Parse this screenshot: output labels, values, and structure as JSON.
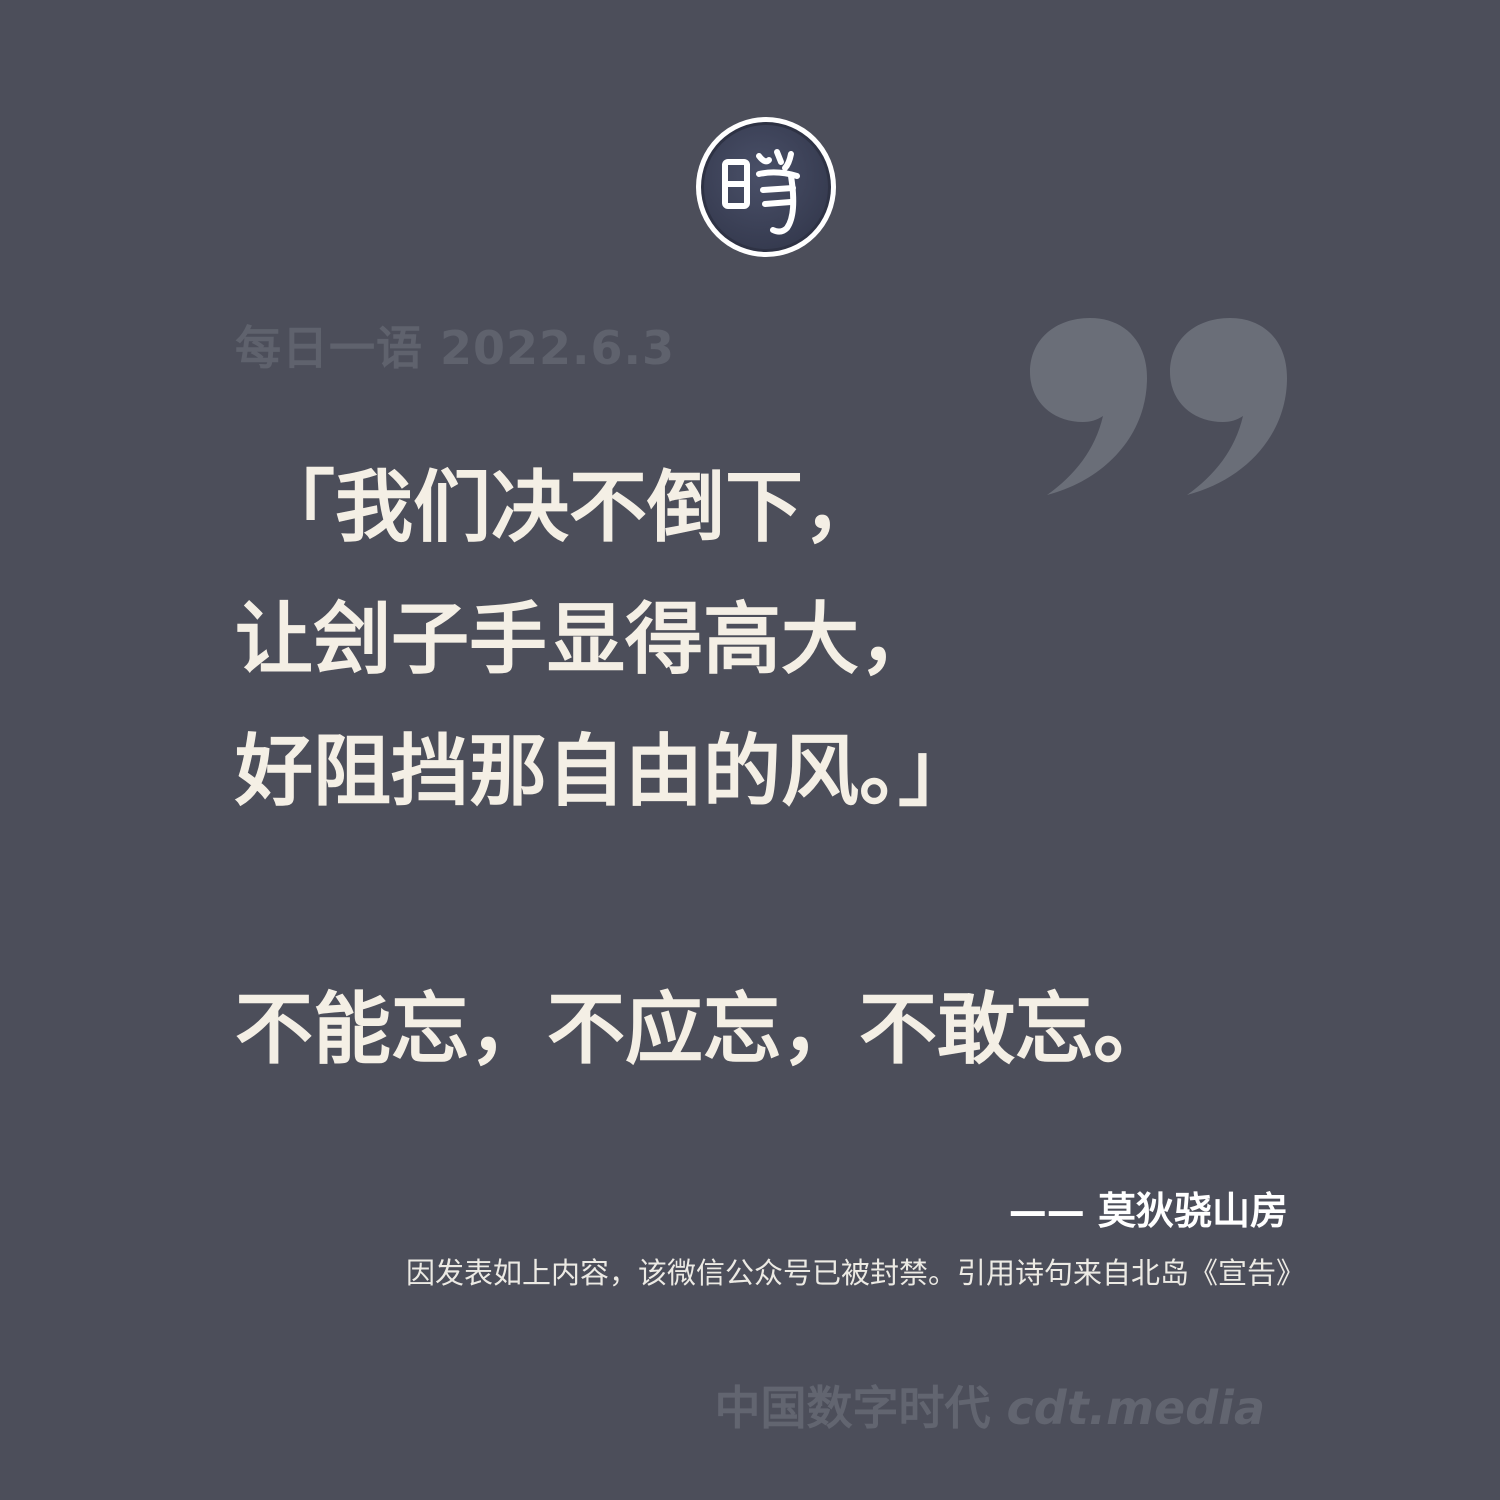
{
  "logo": {
    "icon": "cdt-seal-icon",
    "colors": {
      "ring": "#ffffff",
      "fill": "#3e4459",
      "glyph": "#ffffff"
    }
  },
  "header": {
    "date_line": "每日一语 2022.6.3"
  },
  "quote_mark": {
    "icon": "closing-quote-icon",
    "color": "#6a6e78"
  },
  "poem": {
    "lines": [
      "「我们决不倒下，",
      "让刽子手显得高大，",
      "好阻挡那自由的风。」"
    ]
  },
  "motto": "不能忘，不应忘，不敢忘。",
  "attribution": "—— 莫狄骁山房",
  "note": "因发表如上内容，该微信公众号已被封禁。引用诗句来自北岛《宣告》",
  "footer": {
    "brand_cn": "中国数字时代",
    "site": "cdt.media"
  },
  "colors": {
    "background": "#4c4e5a",
    "text": "#f4efe5",
    "muted": "#5f626d"
  }
}
